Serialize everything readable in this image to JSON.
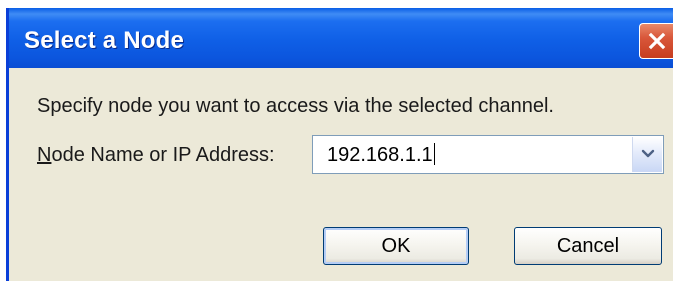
{
  "window": {
    "title": "Select a Node",
    "close_icon": "close-icon"
  },
  "dialog": {
    "instruction": "Specify node you want to access via the selected channel.",
    "field_label_mnemonic": "N",
    "field_label_rest": "ode Name or IP Address:",
    "node_value": "192.168.1.1",
    "dropdown_icon": "chevron-down-icon"
  },
  "buttons": {
    "ok_label": "OK",
    "cancel_label": "Cancel"
  },
  "colors": {
    "titlebar": "#0a5ee6",
    "close_button": "#d9573a",
    "dialog_background": "#ece9d8"
  }
}
